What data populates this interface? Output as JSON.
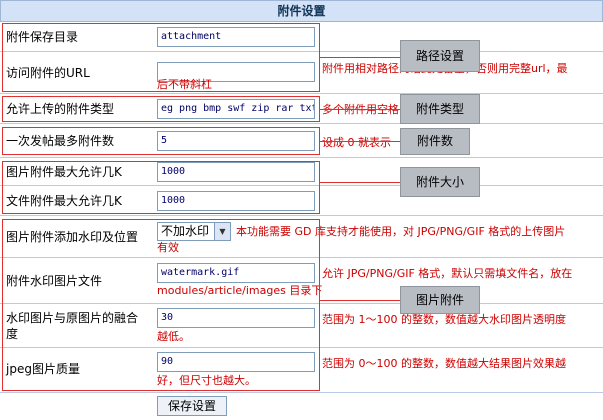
{
  "header": {
    "title": "附件设置"
  },
  "rows": {
    "save_dir": {
      "label": "附件保存目录",
      "value": "attachment"
    },
    "access_url": {
      "label": "访问附件的URL",
      "value": "",
      "desc_line1": "附件用相对路径的话此处留空，否则用完整url，最",
      "desc_line2": "后不带斜杠"
    },
    "types": {
      "label": "允许上传的附件类型",
      "value": "eg png bmp swf zip rar txt",
      "desc": "多个附件用空格"
    },
    "max_count": {
      "label": "一次发帖最多附件数",
      "value": "5",
      "desc": "设成 0 就表示"
    },
    "img_max": {
      "label": "图片附件最大允许几K",
      "value": "1000"
    },
    "file_max": {
      "label": "文件附件最大允许几K",
      "value": "1000"
    },
    "watermark_pos": {
      "label": "图片附件添加水印及位置",
      "selected": "不加水印",
      "desc_line1": "本功能需要 GD 库支持才能使用，对 JPG/PNG/GIF 格式的上传图片",
      "desc_line2": "有效"
    },
    "watermark_file": {
      "label": "附件水印图片文件",
      "value": "watermark.gif",
      "desc_line1": "允许 JPG/PNG/GIF 格式，默认只需填文件名，放在",
      "desc_line2": "modules/article/images 目录下"
    },
    "blend": {
      "label_line1": "水印图片与原图片的融合",
      "label_line2": "度",
      "value": "30",
      "desc_line1": "范围为 1～100 的整数，数值越大水印图片透明度",
      "desc_line2": "越低。"
    },
    "quality": {
      "label": "jpeg图片质量",
      "value": "90",
      "desc_line1": "范围为 0～100 的整数，数值越大结果图片效果越",
      "desc_line2": "好，但尺寸也越大。"
    }
  },
  "submit_label": "保存设置",
  "callouts": {
    "path": "路径设置",
    "types": "附件类型",
    "count": "附件数",
    "size": "附件大小",
    "image": "图片附件"
  },
  "colors": {
    "header_bg": "#d3e2f7",
    "annotation_red": "#e03030",
    "callout_gray": "#b8bdc4"
  }
}
